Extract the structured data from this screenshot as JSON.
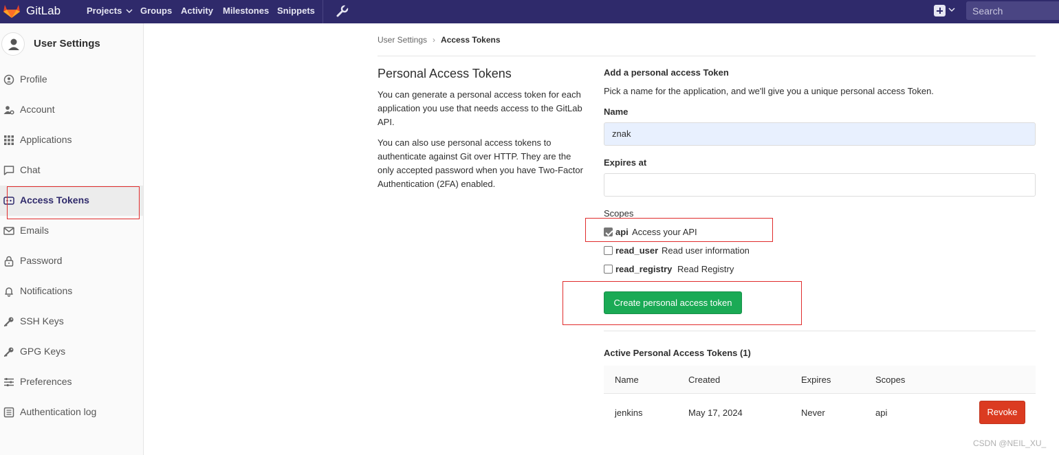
{
  "topbar": {
    "brand": "GitLab",
    "nav": [
      "Projects",
      "Groups",
      "Activity",
      "Milestones",
      "Snippets"
    ],
    "search_placeholder": "Search"
  },
  "sidebar": {
    "title": "User Settings",
    "items": [
      {
        "label": "Profile",
        "icon": "profile-icon"
      },
      {
        "label": "Account",
        "icon": "account-gear-icon"
      },
      {
        "label": "Applications",
        "icon": "applications-grid-icon"
      },
      {
        "label": "Chat",
        "icon": "chat-icon"
      },
      {
        "label": "Access Tokens",
        "icon": "key-card-icon",
        "active": true
      },
      {
        "label": "Emails",
        "icon": "envelope-icon"
      },
      {
        "label": "Password",
        "icon": "lock-icon"
      },
      {
        "label": "Notifications",
        "icon": "bell-icon"
      },
      {
        "label": "SSH Keys",
        "icon": "key-icon"
      },
      {
        "label": "GPG Keys",
        "icon": "key-icon"
      },
      {
        "label": "Preferences",
        "icon": "sliders-icon"
      },
      {
        "label": "Authentication log",
        "icon": "list-icon"
      }
    ]
  },
  "breadcrumb": {
    "parent": "User Settings",
    "current": "Access Tokens"
  },
  "intro": {
    "title": "Personal Access Tokens",
    "p1": "You can generate a personal access token for each application you use that needs access to the GitLab API.",
    "p2": "You can also use personal access tokens to authenticate against Git over HTTP. They are the only accepted password when you have Two-Factor Authentication (2FA) enabled."
  },
  "form": {
    "title": "Add a personal access Token",
    "subtitle": "Pick a name for the application, and we'll give you a unique personal access Token.",
    "name_label": "Name",
    "name_value": "znak",
    "expires_label": "Expires at",
    "expires_value": "",
    "scopes_label": "Scopes",
    "scopes": [
      {
        "name": "api",
        "desc": "Access your API",
        "checked": true
      },
      {
        "name": "read_user",
        "desc": "Read user information",
        "checked": false
      },
      {
        "name": "read_registry",
        "desc": "Read Registry",
        "checked": false
      }
    ],
    "submit_label": "Create personal access token"
  },
  "active_tokens": {
    "title": "Active Personal Access Tokens (1)",
    "columns": [
      "Name",
      "Created",
      "Expires",
      "Scopes"
    ],
    "rows": [
      {
        "name": "jenkins",
        "created": "May 17, 2024",
        "expires": "Never",
        "scopes": "api",
        "action": "Revoke"
      }
    ]
  },
  "watermark": "CSDN @NEIL_XU_",
  "colors": {
    "nav_bg": "#2f2a6b",
    "create_btn": "#1aaa55",
    "revoke_btn": "#db3b21",
    "highlight": "#e02b2b"
  }
}
